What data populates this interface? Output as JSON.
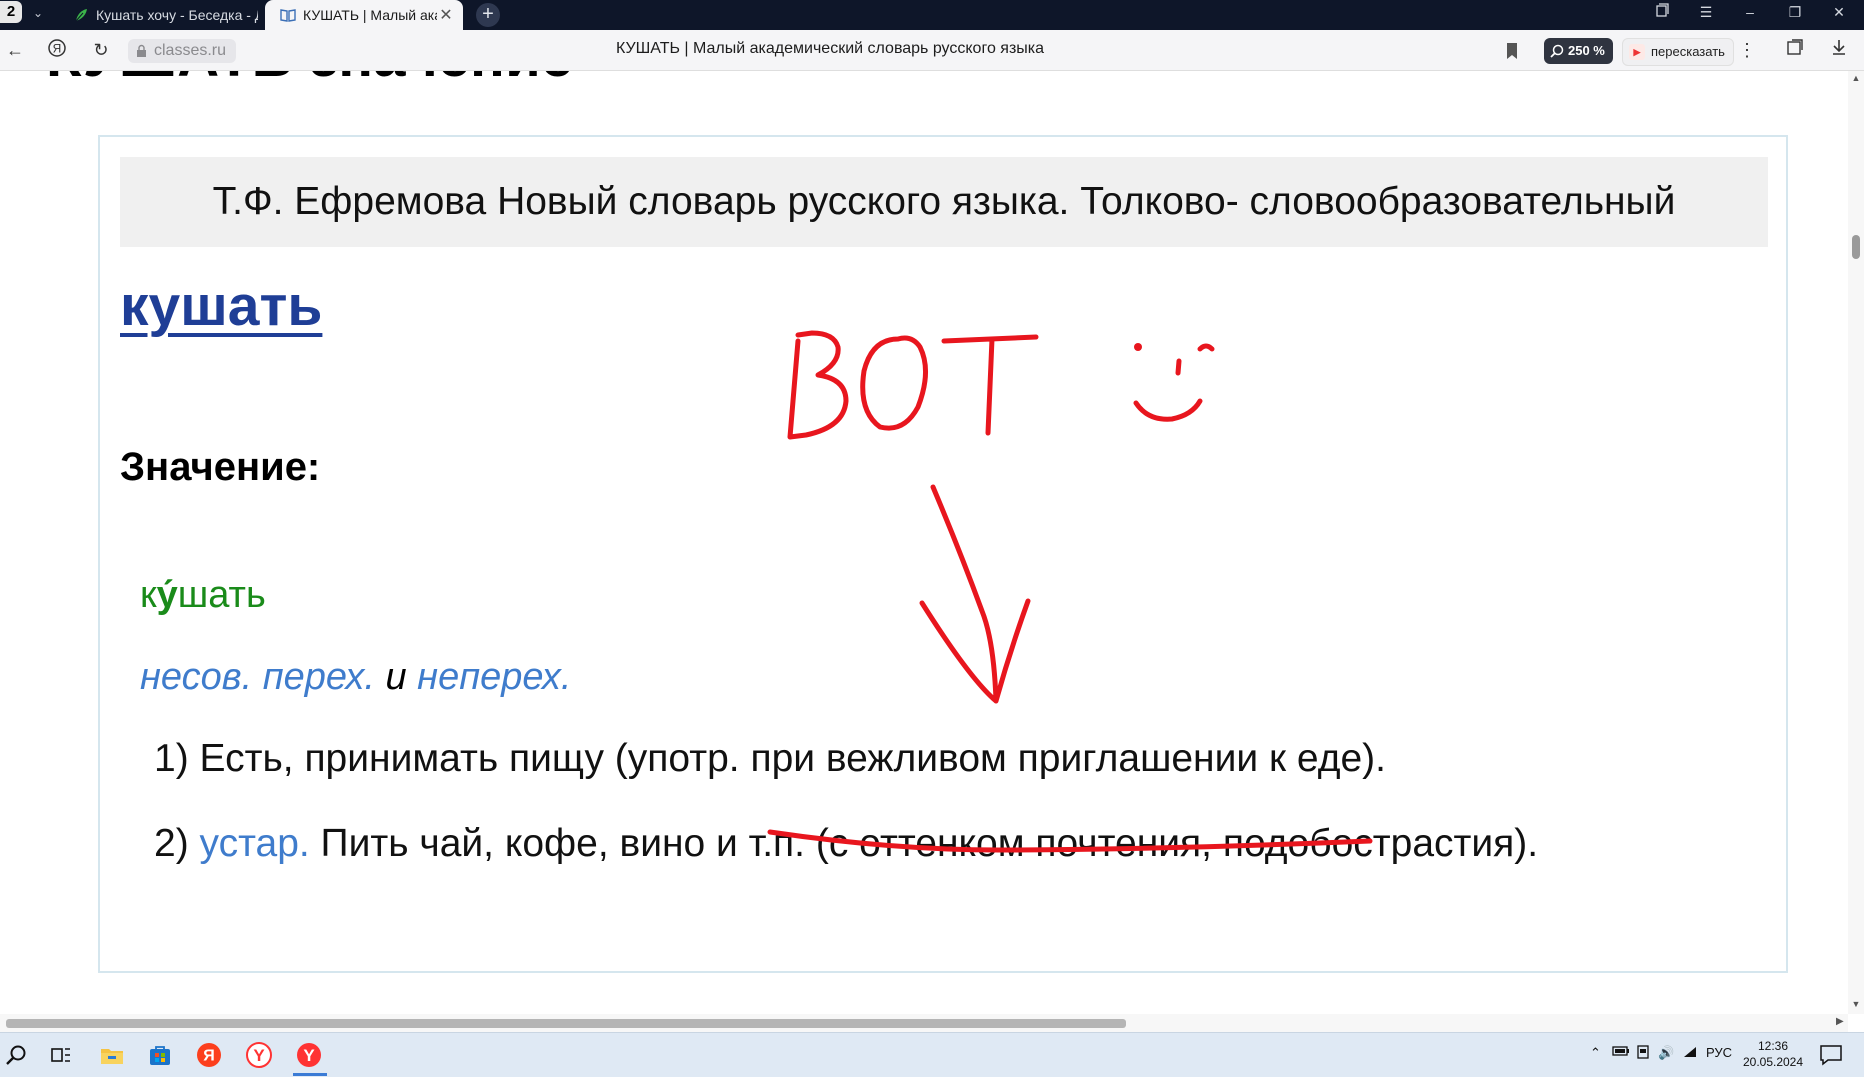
{
  "browser": {
    "tab_count": "2",
    "tabs": [
      {
        "title": "Кушать хочу - Беседка - Д",
        "active": false
      },
      {
        "title": "КУШАТЬ | Малый академ",
        "active": true
      }
    ],
    "url_domain": "classes.ru",
    "page_title": "КУШАТЬ | Малый академический словарь русского языка",
    "zoom": "250 %",
    "retell_label": "пересказать"
  },
  "page": {
    "cut_heading": "КУШАТЬ значение",
    "source": "Т.Ф. Ефремова Новый словарь русского языка. Толково- словообразовательный",
    "headword": "кушать",
    "meaning_label": "Значение:",
    "entry_word": {
      "before": "к",
      "stressed": "у",
      "after": "шать"
    },
    "grammar": {
      "abbr1": "несов. перех.",
      "conj": " и ",
      "abbr2": "неперех."
    },
    "senses": [
      {
        "num": "1) ",
        "text": "Есть, принимать пищу (употр. при вежливом приглашении к еде)."
      },
      {
        "num": "2) ",
        "label": "устар.",
        "text": " Пить чай, кофе, вино и т.п. (с оттенком почтения, подобострастия)."
      }
    ]
  },
  "annotation": {
    "text": "ВОТ",
    "color": "#e8161e",
    "shapes": [
      "smiley",
      "arrow-down",
      "underline"
    ]
  },
  "taskbar": {
    "language": "РУС",
    "time": "12:36",
    "date": "20.05.2024"
  }
}
